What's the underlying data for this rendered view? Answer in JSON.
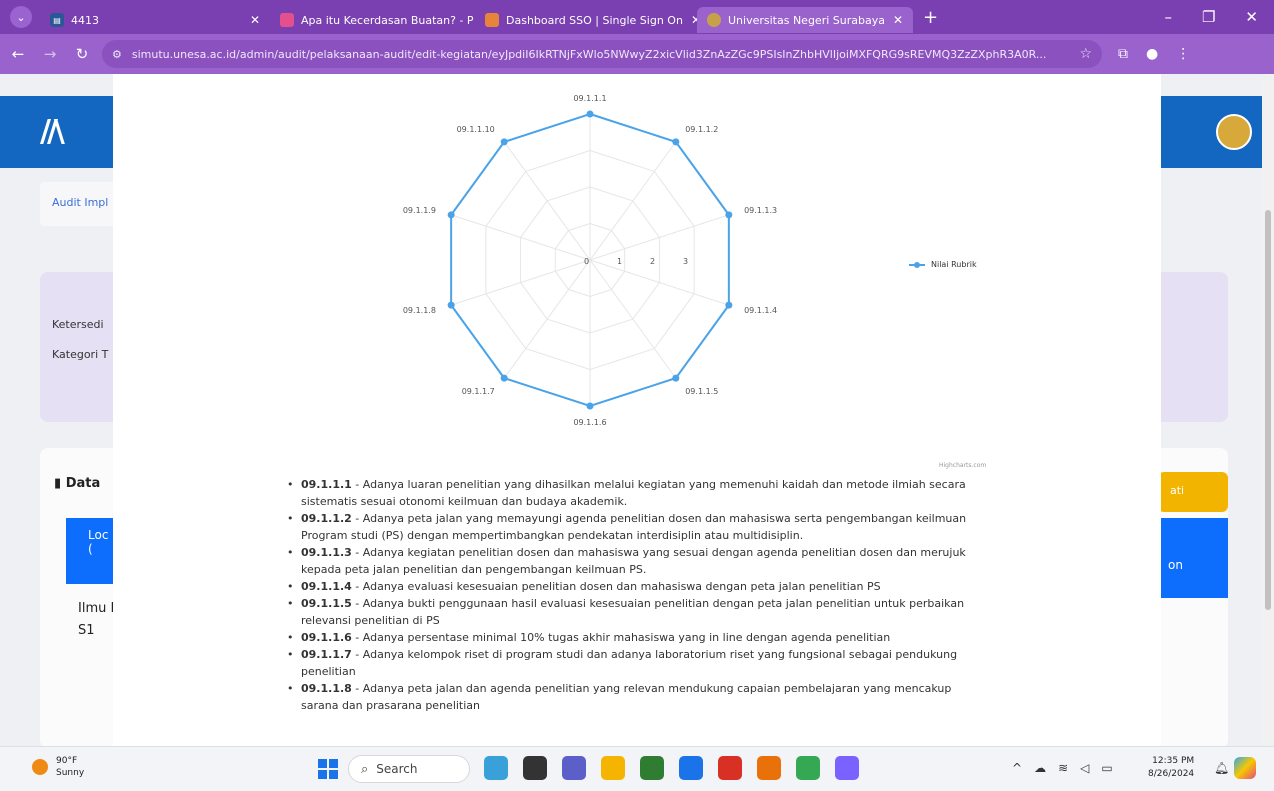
{
  "browser": {
    "tabs": [
      {
        "label": "4413",
        "active": false,
        "color": "#2b5797"
      },
      {
        "label": "Apa itu Kecerdasan Buatan? - P",
        "active": false,
        "color": "#e44f8e"
      },
      {
        "label": "Dashboard SSO | Single Sign On",
        "active": false,
        "color": "#e8833a"
      },
      {
        "label": "Universitas Negeri Surabaya",
        "active": true,
        "color": "#c7a14a"
      }
    ],
    "url": "simutu.unesa.ac.id/admin/audit/pelaksanaan-audit/edit-kegiatan/eyJpdiI6IkRTNjFxWlo5NWwyZ2xicVlid3ZnAzZGc9PSIsInZhbHVlIjoiMXFQRG9sREVMQ3ZzZXphR3A0R...",
    "site_icon": "tune-icon",
    "new_tab": "+"
  },
  "page": {
    "breadcrumb": "Audit Impl",
    "info_label_1": "Ketersedi",
    "info_label_2": "Kategori T",
    "data_title": "Data",
    "blue_block_text": "Loc\n(",
    "right_block_text": "on",
    "yellow_btn_text": "ati",
    "row_text_1": "Ilmu I",
    "row_text_2": "S1"
  },
  "chart_data": {
    "type": "radar",
    "categories": [
      "09.1.1.1",
      "09.1.1.2",
      "09.1.1.3",
      "09.1.1.4",
      "09.1.1.5",
      "09.1.1.6",
      "09.1.1.7",
      "09.1.1.8",
      "09.1.1.9",
      "09.1.1.10"
    ],
    "series": [
      {
        "name": "Nilai Rubrik",
        "values": [
          4,
          4,
          4,
          4,
          4,
          4,
          4,
          4,
          4,
          4
        ]
      }
    ],
    "radial_ticks": [
      "0",
      "1",
      "2",
      "3"
    ],
    "rlim": [
      0,
      4
    ],
    "legend": "right",
    "grid": true,
    "color": "#4aa3e8",
    "credit": "Highcharts.com"
  },
  "descriptions": [
    {
      "code": "09.1.1.1",
      "text": " - Adanya luaran penelitian yang dihasilkan melalui kegiatan yang memenuhi kaidah dan metode ilmiah secara sistematis sesuai otonomi keilmuan dan budaya akademik."
    },
    {
      "code": "09.1.1.2",
      "text": " - Adanya peta jalan yang memayungi agenda penelitian dosen dan mahasiswa serta pengembangan keilmuan Program studi (PS) dengan mempertimbangkan pendekatan interdisiplin atau multidisiplin."
    },
    {
      "code": "09.1.1.3",
      "text": " - Adanya kegiatan penelitian dosen dan mahasiswa yang sesuai dengan agenda penelitian dosen dan merujuk kepada peta jalan penelitian dan pengembangan keilmuan PS."
    },
    {
      "code": "09.1.1.4",
      "text": " - Adanya evaluasi kesesuaian penelitian dosen dan mahasiswa dengan peta jalan penelitian PS"
    },
    {
      "code": "09.1.1.5",
      "text": " - Adanya bukti penggunaan hasil evaluasi kesesuaian penelitian dengan peta jalan penelitian untuk perbaikan relevansi penelitian di PS"
    },
    {
      "code": "09.1.1.6",
      "text": " - Adanya persentase minimal 10% tugas akhir mahasiswa yang in line dengan agenda penelitian"
    },
    {
      "code": "09.1.1.7",
      "text": " - Adanya kelompok riset di program studi dan adanya laboratorium riset yang fungsional sebagai pendukung penelitian"
    },
    {
      "code": "09.1.1.8",
      "text": " - Adanya peta jalan dan agenda penelitian yang relevan mendukung capaian pembelajaran yang mencakup sarana dan prasarana penelitian"
    }
  ],
  "taskbar": {
    "temperature": "90°F",
    "condition": "Sunny",
    "search_placeholder": "Search",
    "time": "12:35 PM",
    "date": "8/26/2024",
    "app_colors": [
      "#3aa0d8",
      "#333333",
      "#5b5fc7",
      "#f4b400",
      "#2e7d32",
      "#1a73e8",
      "#d93025",
      "#e8710a",
      "#34a853",
      "#7b61ff"
    ]
  }
}
